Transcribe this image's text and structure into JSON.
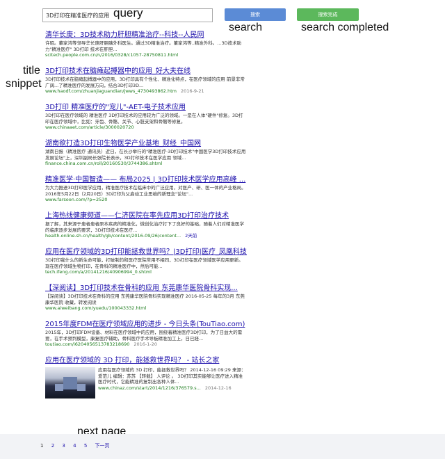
{
  "toolbar": {
    "query_value": "3D打印在精准医疗的应用",
    "search_label": "搜索",
    "complete_label": "搜索完成"
  },
  "annotations": {
    "query": "query",
    "search": "search",
    "search_completed": "search completed",
    "title": "title",
    "snippet": "snippet",
    "next_page": "next page"
  },
  "results": [
    {
      "title": "清华长庚：3D技术助力肝胆精准治疗--科技--人民网",
      "snippet": "许昭。董家鸿等领导华长庚肝胆胰外科医生。通过3D精准治疗。董家鸿等..精准外科。...3D技术助力\"精准医疗\" 3D打印 技术在肝胆...",
      "url": "scitech.people.com.cn/n/2016/0328/c1057-28750811.html",
      "date": ""
    },
    {
      "title": "3D打印技术在脑瘫起搏器中的应用_好大夫在线",
      "snippet": "3D打印技术在脑瘫起搏器中的应用，3D打印具有个性化、精准化特点，在医疗领域的应用 前景非常广阔...了精准医疗的发展方向，结合3D打印3D...",
      "url": "www.haodf.com/zhuanjiaguandian/jwws_4730493862.htm",
      "date": "2016-9-21"
    },
    {
      "title": "3D打印 精准医疗的\"宠儿\"-AET-电子技术应用",
      "snippet": "3D打印在医疗领域的 精准医疗 3D打印技术的应用较为广泛的领域。一是在人体\"硬件\"修复。3D打印在医疗领域中，比如：牙齿、骨骼、关节、心脏支架和骨骼等修复。",
      "url": "www.chinaaet.com/article/3000020720",
      "date": ""
    },
    {
      "title": "湖南欲打造3D打印生物医学产业基地_财经_中国网",
      "snippet": "湖南日报（精准医疗 通讯员）近日，在长沙举行的\"精准医疗·3D打印技术\"中国医学3D打印技术应用发展论坛\"上，深圳副局长张院长表示，3D打印技术在医学应用 领域...",
      "url": "finance.china.com.cn/roll/20160530/3744386.shtml",
      "date": ""
    },
    {
      "title": "精准医学·中国智造—— 布局2025 | 3D打印技术医学应用高峰 ...",
      "snippet": "为大力推进3D打印医学应用，精准医疗技术在临床中的广泛应用，对医产、研、医一体的产业格局。2016年5月22日（2月20日）3D打印为父启动工业思维的新理念\"论坛\"...",
      "url": "www.farsoon.com/?p=2520",
      "date": ""
    },
    {
      "title": "上海热线健康频道——仁济医院在率先应用3D打印治疗技术",
      "snippet": "据了解，其来源于患者患者原本疾病的精准化，微创化治疗打下了良好的基础，随着人们对精准医学的临床逐步发展的要求，3D打印技术在医疗...",
      "url": "health.online.sh.cn/health/gb/content/2016-09/26/content...",
      "date": "2天前",
      "date_blue": true
    },
    {
      "title": "应用在医疗领域的3D打印能拯救世界吗？|3D打印|医疗_凤凰科技",
      "snippet": "3D打印我什么的新生命可能，打破制药和医疗医院常用不相同，3D打印在医疗领域医学应用更新。现在医疗领域生物打印，在骨科的精准医疗中，然后可能...",
      "url": "tech.ifeng.com/a/20141216/40906994_0.shtml",
      "date": ""
    },
    {
      "title": "【深阅读】3D打印技术在骨科的应用 东莞康华医院骨科实现...",
      "snippet": "【深阅读】3D打印技术在骨科的应用 东莞康华医院骨科实现精准医疗 2016-05-25 每年的3月 东莞康华医院 收藏，转发阅读",
      "url": "www.aiweibang.com/yuedu/100043332.html",
      "date": ""
    },
    {
      "title": "2015年度FDM在医疗领域应用的进步 - 今日头条(TouTiao.com)",
      "snippet": "2015年，3D打印FDM设备、材料在医疗领域中的应用，围绕着精准医疗3D打印，为了日益大的需要，在手术预判模型，康复医疗辅助，骨科医疗手术导板精准加工上，日已経...",
      "url": "toutiao.com/i6204056513783218690",
      "date": "2016-1-20"
    }
  ],
  "image_result": {
    "title": "应用在医疗领域的 3D 打印，能拯救世界吗？ - 站长之家",
    "snippet": "应用在医疗领域的 3D 打印，能拯救世界吗？ 2014-12-16 09:29 来源：爱范儿 编辑：苏苏 【转载】 人评论 。 3D打印其实能够让医疗进入精准医疗时代，它能精准的复制出各种人体...",
    "url": "www.chinaz.com/start/2014/1216/376579.s...",
    "date": "2014-12-16"
  },
  "pager": {
    "current": "1",
    "pages": [
      "2",
      "3",
      "4",
      "5"
    ],
    "next": "下一页"
  }
}
